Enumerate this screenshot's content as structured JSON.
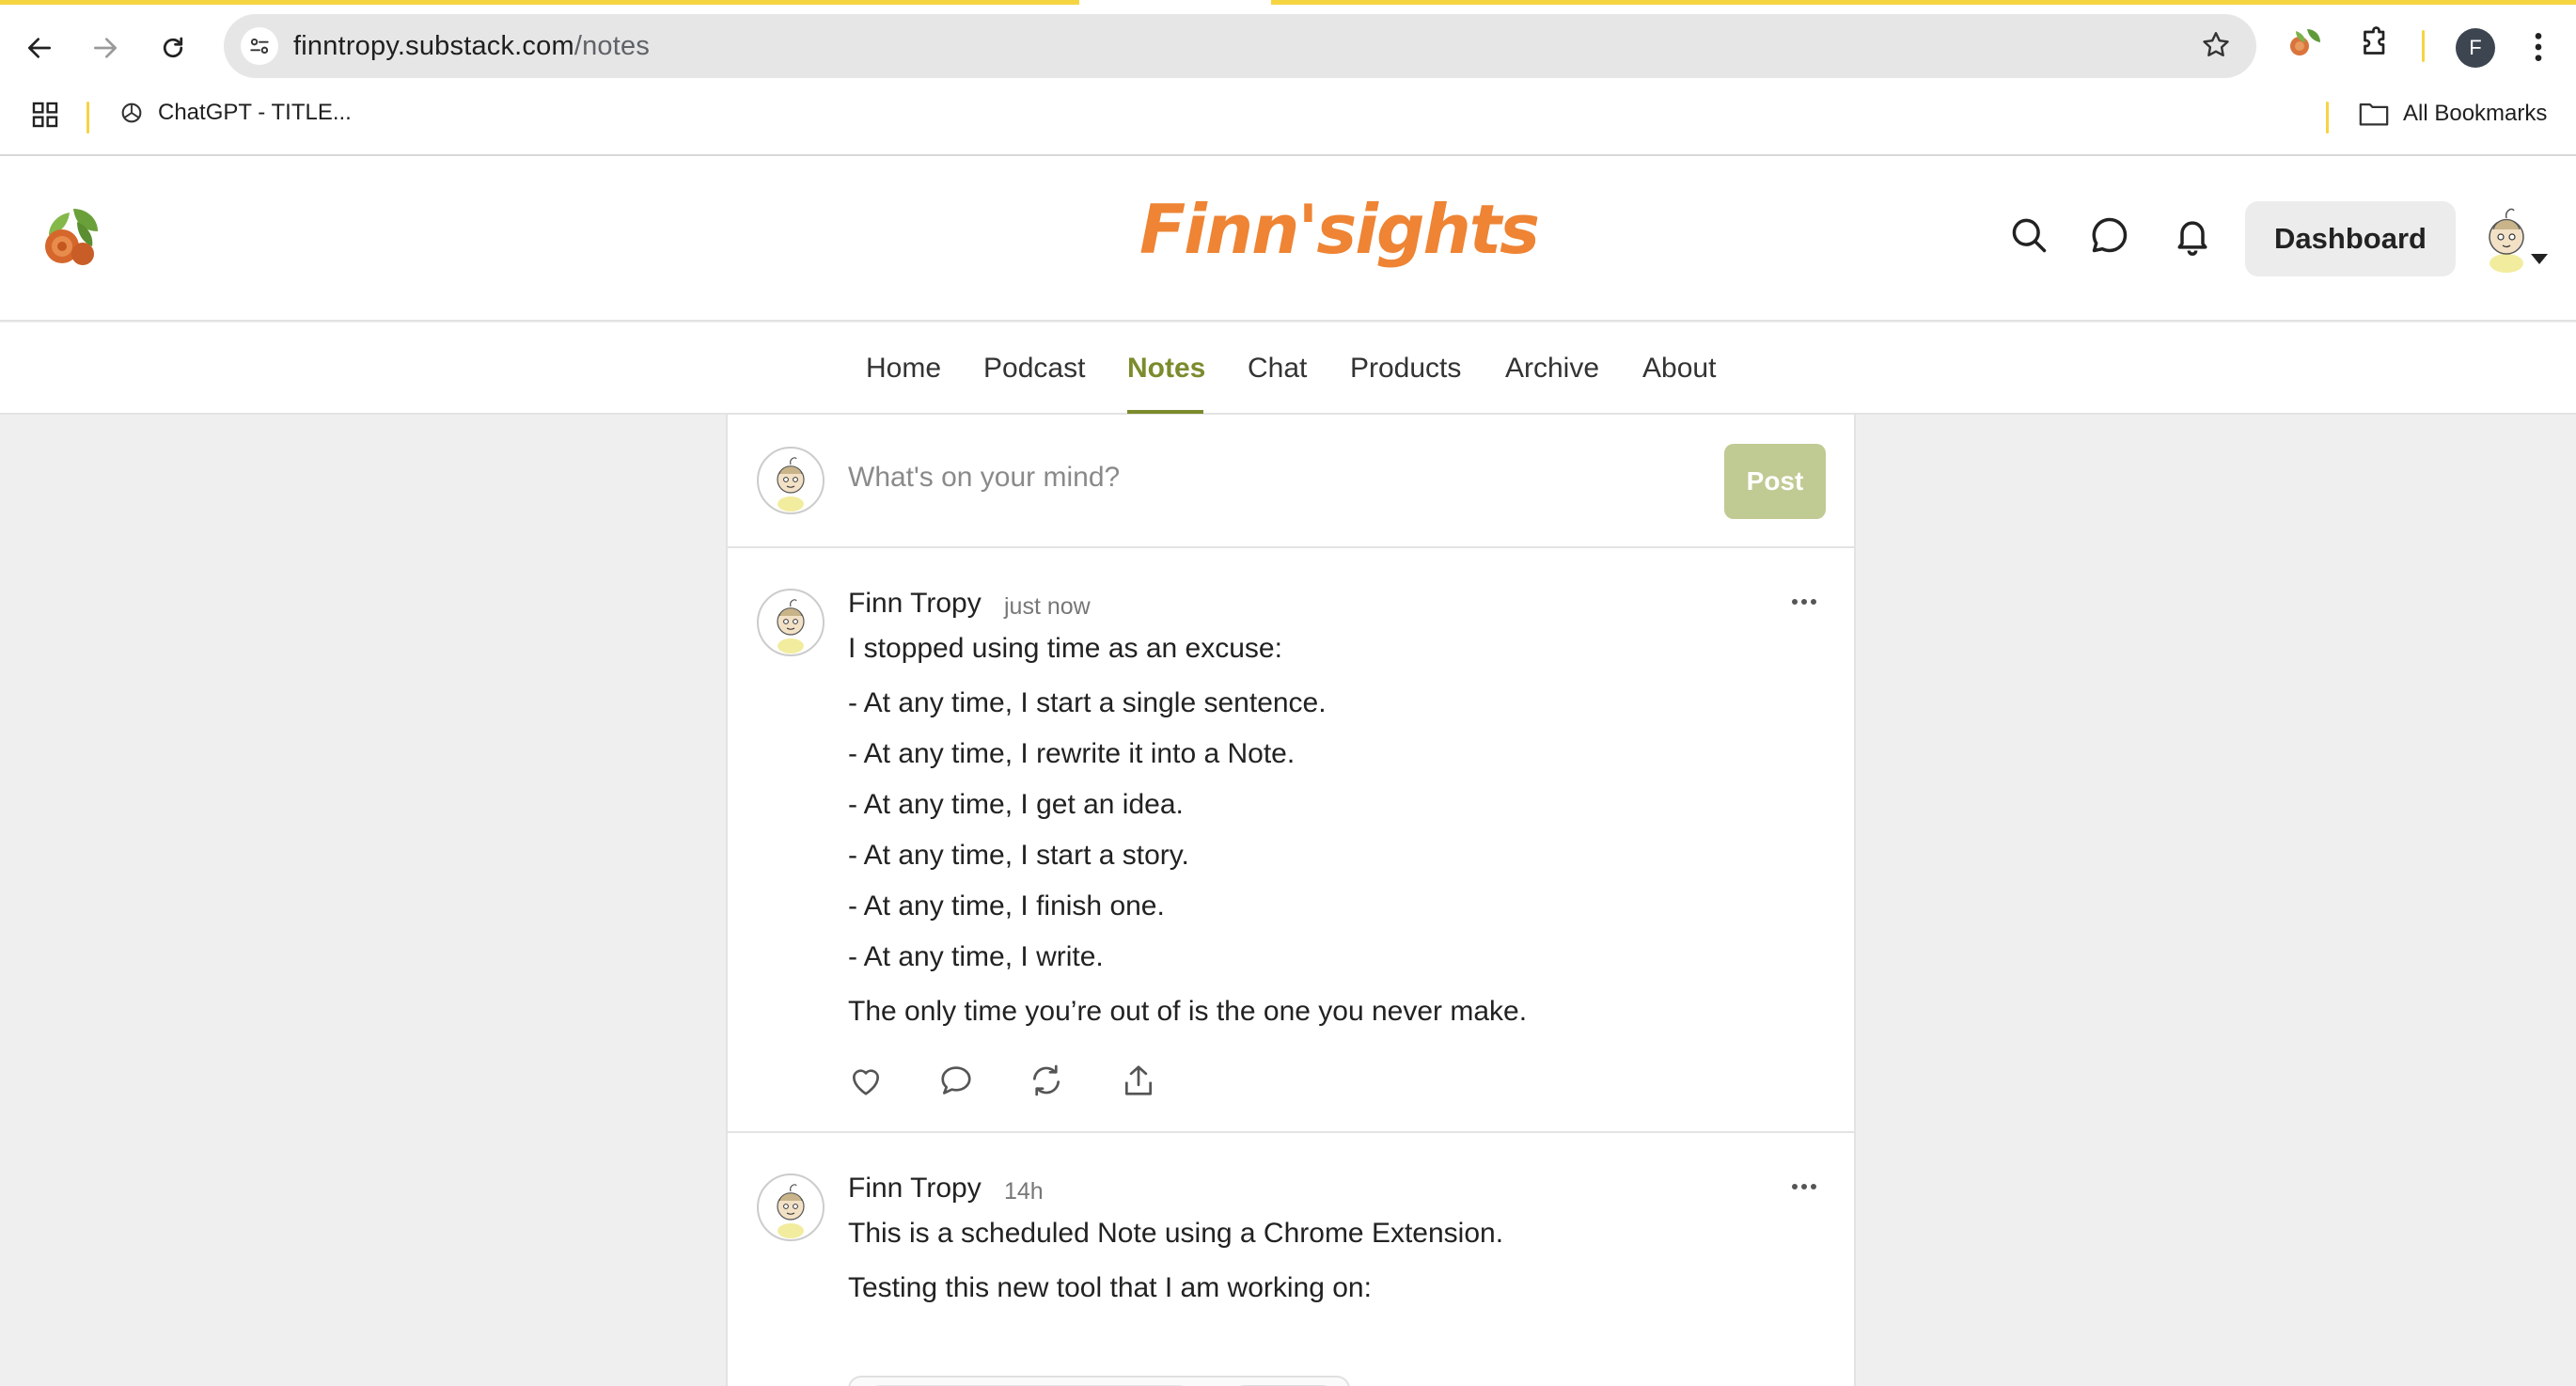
{
  "browser": {
    "url_host": "finntropy.substack.com",
    "url_path": "/notes",
    "bookmark_label": "ChatGPT - TITLE...",
    "all_bookmarks_label": "All Bookmarks",
    "profile_initial": "F",
    "accent_color": "#f5d442"
  },
  "site": {
    "brand": "Finn'sights",
    "brand_color": "#ee8434",
    "dashboard_label": "Dashboard"
  },
  "nav": {
    "tabs": [
      "Home",
      "Podcast",
      "Notes",
      "Chat",
      "Products",
      "Archive",
      "About"
    ],
    "active": "Notes",
    "active_color": "#7c8b2c"
  },
  "composer": {
    "placeholder": "What's on your mind?",
    "post_label": "Post"
  },
  "notes": [
    {
      "author": "Finn Tropy",
      "time": "just now",
      "lines": [
        "I stopped using time as an excuse:",
        "- At any time, I start a single sentence.",
        "- At any time, I rewrite it into a Note.",
        "- At any time, I get an idea.",
        "- At any time, I start a story.",
        "- At any time, I finish one.",
        "- At any time, I write.",
        "The only time you’re out of is the one you never make."
      ]
    },
    {
      "author": "Finn Tropy",
      "time": "14h",
      "lines": [
        "This is a scheduled Note using a Chrome Extension.",
        "Testing this new tool that I am working on:"
      ]
    }
  ]
}
